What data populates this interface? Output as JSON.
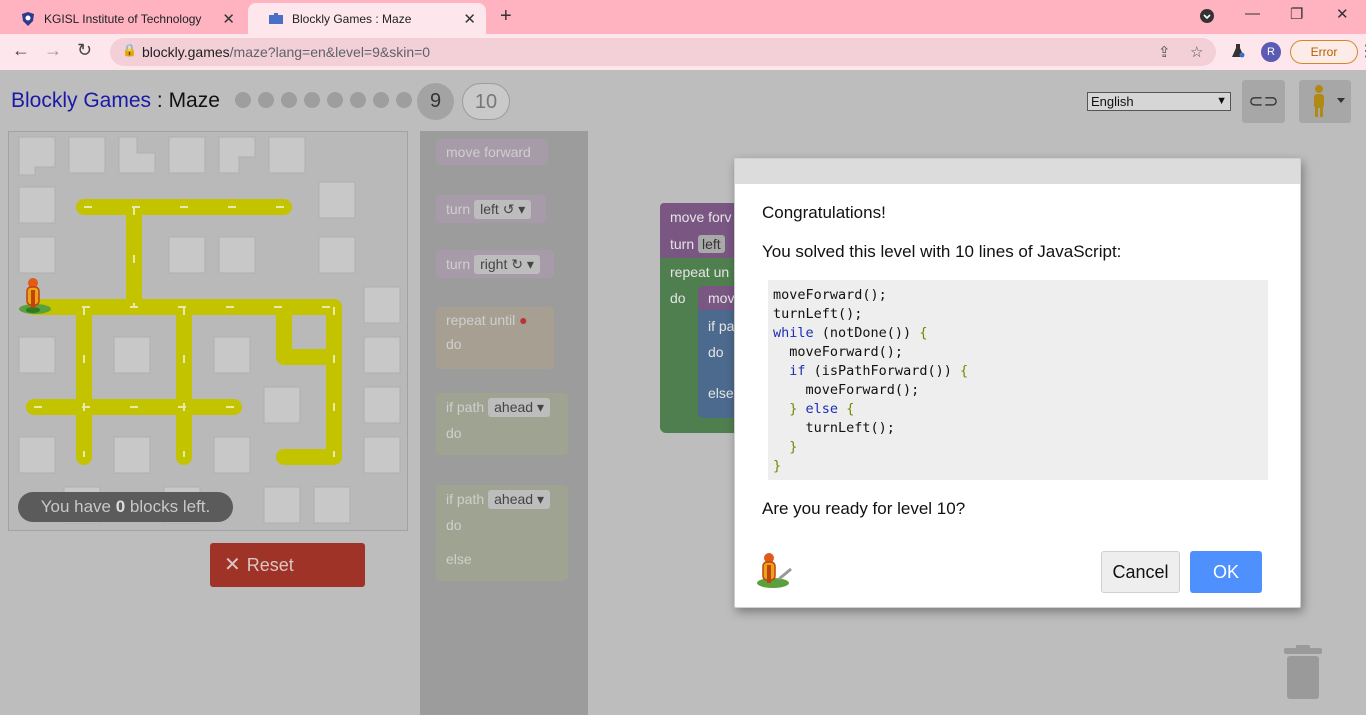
{
  "browser": {
    "tabs": [
      {
        "title": "KGISL Institute of Technology",
        "active": false
      },
      {
        "title": "Blockly Games : Maze",
        "active": true
      }
    ],
    "url_host": "blockly.games",
    "url_path": "/maze?lang=en&level=9&skin=0",
    "profile_initial": "R",
    "error_label": "Error"
  },
  "header": {
    "brand": "Blockly Games",
    "separator": " : ",
    "game": "Maze",
    "current_level": "9",
    "next_level": "10",
    "language": "English"
  },
  "maze": {
    "blocks_left_prefix": "You have ",
    "blocks_left_count": "0",
    "blocks_left_suffix": " blocks left.",
    "reset_label": "Reset",
    "colors": {
      "path": "#c3c300",
      "tile": "#c8c8c8"
    }
  },
  "toolbox": {
    "move_forward": "move forward",
    "turn_label": "turn",
    "turn_left_value": "left ↺",
    "turn_right_value": "right ↻",
    "repeat_until": "repeat until",
    "do_label": "do",
    "if_path": "if path",
    "ahead": "ahead",
    "else_label": "else"
  },
  "workspace": {
    "move_fwd_partial": "move forv",
    "turn_partial": "turn",
    "left_partial": "left",
    "repeat_partial": "repeat un",
    "do": "do",
    "mov_partial": "mov",
    "if_partial": "if pa",
    "do2": "do",
    "else_partial": "else"
  },
  "dialog": {
    "congrats": "Congratulations!",
    "solved": "You solved this level with 10 lines of JavaScript:",
    "ready": "Are you ready for level 10?",
    "cancel": "Cancel",
    "ok": "OK",
    "code_lines": [
      "moveForward();",
      "turnLeft();",
      "while (notDone()) {",
      "  moveForward();",
      "  if (isPathForward()) {",
      "    moveForward();",
      "  } else {",
      "    turnLeft();",
      "  }",
      "}"
    ]
  }
}
